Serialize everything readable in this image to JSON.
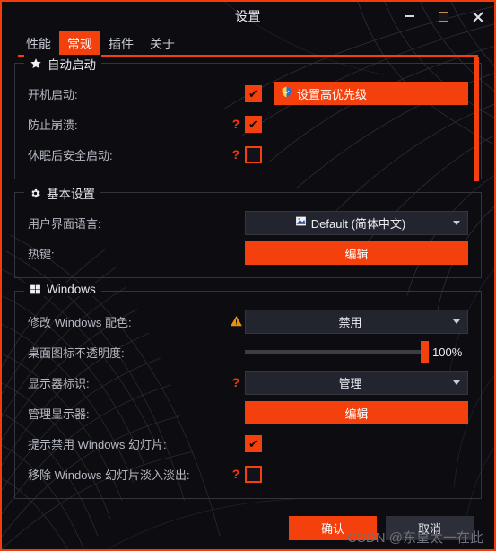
{
  "window": {
    "title": "设置",
    "accent_color": "#f4400d",
    "background_color": "#0c0c11",
    "controls": {
      "minimize": "minimize-icon",
      "maximize": "maximize-icon",
      "close": "close-icon"
    }
  },
  "tabs": [
    {
      "label": "性能",
      "active": false
    },
    {
      "label": "常规",
      "active": true
    },
    {
      "label": "插件",
      "active": false
    },
    {
      "label": "关于",
      "active": false
    }
  ],
  "groups": [
    {
      "title": "自动启动",
      "icon": "star-icon",
      "rows": [
        {
          "label": "开机启动:",
          "help": false,
          "control": "checkbox+button",
          "checked": true,
          "button_label": "设置高优先级",
          "button_icon": "shield-icon"
        },
        {
          "label": "防止崩溃:",
          "help": true,
          "control": "checkbox",
          "checked": true
        },
        {
          "label": "休眠后安全启动:",
          "help": true,
          "control": "checkbox",
          "checked": false
        }
      ]
    },
    {
      "title": "基本设置",
      "icon": "gear-icon",
      "rows": [
        {
          "label": "用户界面语言:",
          "help": false,
          "control": "dropdown",
          "value": "Default (简体中文)",
          "value_icon": "flag-icon"
        },
        {
          "label": "热键:",
          "help": false,
          "control": "button",
          "button_label": "编辑"
        }
      ]
    },
    {
      "title": "Windows",
      "icon": "windows-icon",
      "rows": [
        {
          "label": "修改 Windows 配色:",
          "warn": true,
          "control": "dropdown",
          "value": "禁用"
        },
        {
          "label": "桌面图标不透明度:",
          "help": false,
          "control": "slider",
          "value": "100%",
          "percent": 100
        },
        {
          "label": "显示器标识:",
          "help": true,
          "control": "dropdown",
          "value": "管理"
        },
        {
          "label": "管理显示器:",
          "help": false,
          "control": "button",
          "button_label": "编辑"
        },
        {
          "label": "提示禁用 Windows 幻灯片:",
          "help": false,
          "control": "checkbox",
          "checked": true
        },
        {
          "label": "移除 Windows 幻灯片淡入淡出:",
          "help": true,
          "control": "checkbox",
          "checked": false
        }
      ]
    }
  ],
  "help_marker": "?",
  "footer": {
    "confirm_label": "确认",
    "cancel_label": "取消"
  },
  "watermark": "CSDN @东皇太一在此",
  "scrollbar": {
    "thumb_color": "#f4400d"
  }
}
